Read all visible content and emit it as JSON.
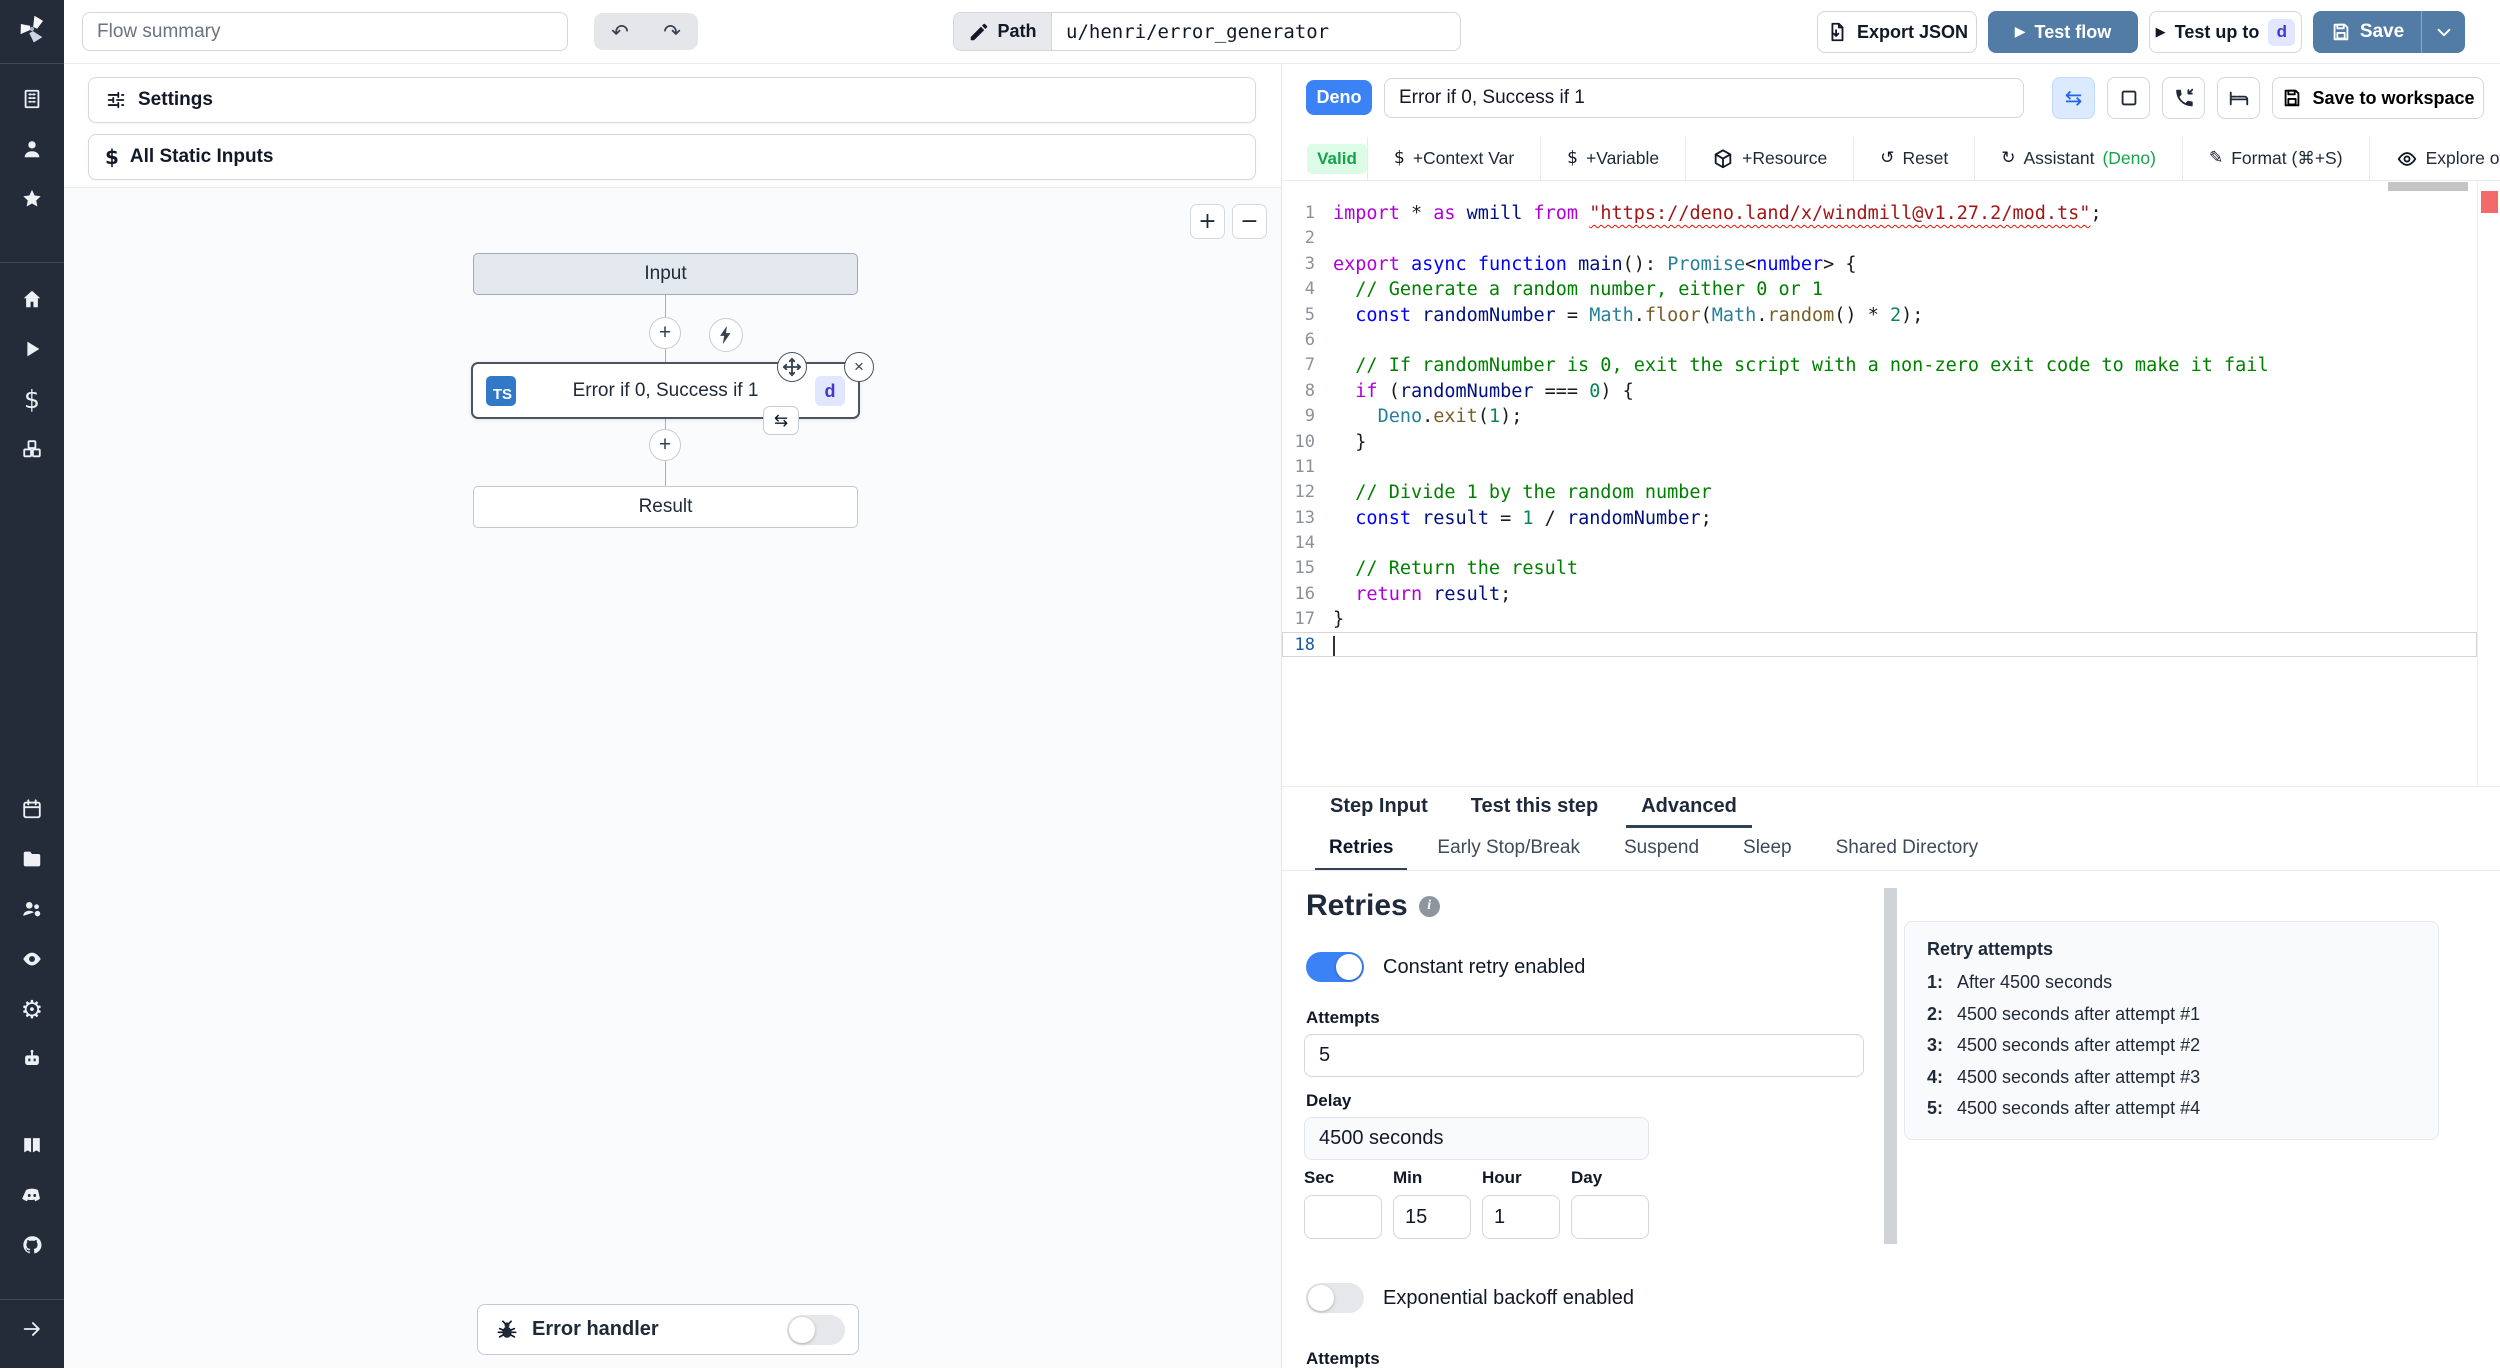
{
  "topbar": {
    "flow_summary_placeholder": "Flow summary",
    "path_label": "Path",
    "path_value": "u/henri/error_generator",
    "export_json_label": "Export JSON",
    "test_flow_label": "Test flow",
    "test_up_to_label": "Test up to",
    "step_badge": "d",
    "save_label": "Save"
  },
  "sidebar": {
    "groups": [
      [
        "building",
        "user",
        "star"
      ],
      [
        "home",
        "play",
        "dollar",
        "cubes"
      ],
      [
        "calendar",
        "folder",
        "users-gear",
        "eye",
        "gear",
        "robot"
      ],
      [
        "book",
        "discord",
        "github"
      ]
    ],
    "expand_icon": "arrow-right"
  },
  "flow_panel": {
    "settings_label": "Settings",
    "all_static_inputs_label": "All Static Inputs",
    "zoom_in": "+",
    "zoom_out": "−",
    "input_node_label": "Input",
    "step_node_label": "Error if 0, Success if 1",
    "ts_badge": "TS",
    "step_badge": "d",
    "result_node_label": "Result",
    "error_handler_label": "Error handler"
  },
  "step_panel": {
    "lang_badge": "Deno",
    "title_value": "Error if 0, Success if 1",
    "save_to_workspace_label": "Save to workspace",
    "validity_badge": "Valid",
    "toolbar_items": [
      {
        "icon": "dollar",
        "label": "+Context Var"
      },
      {
        "icon": "dollar",
        "label": "+Variable"
      },
      {
        "icon": "cube",
        "label": "+Resource"
      },
      {
        "icon": "reset",
        "label": "Reset"
      },
      {
        "icon": "assistant",
        "label": "Assistant ",
        "suffix": "(Deno)"
      },
      {
        "icon": "format-pen",
        "label": "Format (⌘+S)"
      },
      {
        "icon": "eye-outline",
        "label": "Explore other s"
      }
    ],
    "tabs": [
      {
        "label": "Step Input",
        "active": false
      },
      {
        "label": "Test this step",
        "active": false
      },
      {
        "label": "Advanced",
        "active": true
      }
    ],
    "subtabs": [
      {
        "label": "Retries",
        "active": true
      },
      {
        "label": "Early Stop/Break",
        "active": false
      },
      {
        "label": "Suspend",
        "active": false
      },
      {
        "label": "Sleep",
        "active": false
      },
      {
        "label": "Shared Directory",
        "active": false
      }
    ]
  },
  "editor": {
    "lines": [
      {
        "n": 1,
        "segs": [
          [
            "kw",
            "import"
          ],
          [
            "pl",
            " * "
          ],
          [
            "kw",
            "as"
          ],
          [
            "pl",
            " "
          ],
          [
            "var",
            "wmill"
          ],
          [
            "pl",
            " "
          ],
          [
            "kw",
            "from"
          ],
          [
            "pl",
            " "
          ],
          [
            "strw",
            "\"https://deno.land/x/windmill@v1.27.2/mod.ts\""
          ],
          [
            "pl",
            ";"
          ]
        ]
      },
      {
        "n": 2,
        "segs": []
      },
      {
        "n": 3,
        "segs": [
          [
            "kw",
            "export"
          ],
          [
            "pl",
            " "
          ],
          [
            "decl",
            "async"
          ],
          [
            "pl",
            " "
          ],
          [
            "decl",
            "function"
          ],
          [
            "pl",
            " "
          ],
          [
            "var",
            "main"
          ],
          [
            "pl",
            "(): "
          ],
          [
            "type",
            "Promise"
          ],
          [
            "pl",
            "<"
          ],
          [
            "decl",
            "number"
          ],
          [
            "pl",
            "> {"
          ]
        ]
      },
      {
        "n": 4,
        "segs": [
          [
            "com",
            "  // Generate a random number, either 0 or 1"
          ]
        ]
      },
      {
        "n": 5,
        "segs": [
          [
            "pl",
            "  "
          ],
          [
            "decl",
            "const"
          ],
          [
            "pl",
            " "
          ],
          [
            "var",
            "randomNumber"
          ],
          [
            "pl",
            " = "
          ],
          [
            "type",
            "Math"
          ],
          [
            "pl",
            "."
          ],
          [
            "fn",
            "floor"
          ],
          [
            "pl",
            "("
          ],
          [
            "type",
            "Math"
          ],
          [
            "pl",
            "."
          ],
          [
            "fn",
            "random"
          ],
          [
            "pl",
            "() * "
          ],
          [
            "num",
            "2"
          ],
          [
            "pl",
            ");"
          ]
        ]
      },
      {
        "n": 6,
        "segs": []
      },
      {
        "n": 7,
        "segs": [
          [
            "com",
            "  // If randomNumber is 0, exit the script with a non-zero exit code to make it fail"
          ]
        ]
      },
      {
        "n": 8,
        "segs": [
          [
            "pl",
            "  "
          ],
          [
            "kw",
            "if"
          ],
          [
            "pl",
            " ("
          ],
          [
            "var",
            "randomNumber"
          ],
          [
            "pl",
            " === "
          ],
          [
            "num",
            "0"
          ],
          [
            "pl",
            ") {"
          ]
        ]
      },
      {
        "n": 9,
        "segs": [
          [
            "pl",
            "    "
          ],
          [
            "type",
            "Deno"
          ],
          [
            "pl",
            "."
          ],
          [
            "fn",
            "exit"
          ],
          [
            "pl",
            "("
          ],
          [
            "num",
            "1"
          ],
          [
            "pl",
            ");"
          ]
        ]
      },
      {
        "n": 10,
        "segs": [
          [
            "pl",
            "  }"
          ]
        ]
      },
      {
        "n": 11,
        "segs": []
      },
      {
        "n": 12,
        "segs": [
          [
            "com",
            "  // Divide 1 by the random number"
          ]
        ]
      },
      {
        "n": 13,
        "segs": [
          [
            "pl",
            "  "
          ],
          [
            "decl",
            "const"
          ],
          [
            "pl",
            " "
          ],
          [
            "var",
            "result"
          ],
          [
            "pl",
            " = "
          ],
          [
            "num",
            "1"
          ],
          [
            "pl",
            " / "
          ],
          [
            "var",
            "randomNumber"
          ],
          [
            "pl",
            ";"
          ]
        ]
      },
      {
        "n": 14,
        "segs": []
      },
      {
        "n": 15,
        "segs": [
          [
            "com",
            "  // Return the result"
          ]
        ]
      },
      {
        "n": 16,
        "segs": [
          [
            "pl",
            "  "
          ],
          [
            "kw",
            "return"
          ],
          [
            "pl",
            " "
          ],
          [
            "var",
            "result"
          ],
          [
            "pl",
            ";"
          ]
        ]
      },
      {
        "n": 17,
        "segs": [
          [
            "pl",
            "}"
          ]
        ]
      },
      {
        "n": 18,
        "segs": [],
        "current": true
      }
    ]
  },
  "retries": {
    "heading": "Retries",
    "constant_toggle_label": "Constant retry enabled",
    "constant_toggle_on": true,
    "attempts_label": "Attempts",
    "attempts_value": "5",
    "delay_label": "Delay",
    "delay_value": "4500 seconds",
    "time_fields": [
      {
        "label": "Sec",
        "value": ""
      },
      {
        "label": "Min",
        "value": "15"
      },
      {
        "label": "Hour",
        "value": "1"
      },
      {
        "label": "Day",
        "value": ""
      }
    ],
    "exponential_toggle_label": "Exponential backoff enabled",
    "exponential_toggle_on": false,
    "clipped_label": "Attempts",
    "attempts_box": {
      "title": "Retry attempts",
      "items": [
        {
          "num": "1:",
          "text": "After 4500 seconds"
        },
        {
          "num": "2:",
          "text": "4500 seconds after attempt #1"
        },
        {
          "num": "3:",
          "text": "4500 seconds after attempt #2"
        },
        {
          "num": "4:",
          "text": "4500 seconds after attempt #3"
        },
        {
          "num": "5:",
          "text": "4500 seconds after attempt #4"
        }
      ]
    }
  },
  "colors": {
    "primary_button": "#527ba6",
    "deno_badge": "#3b82f6",
    "toggle_on": "#3b82f6",
    "valid_bg": "#dcfce7",
    "valid_text": "#16a34a",
    "ts_badge": "#3178c6",
    "lavender_badge_bg": "#e0e7ff",
    "lavender_badge_text": "#4338ca",
    "sidebar_bg": "#252c39"
  }
}
